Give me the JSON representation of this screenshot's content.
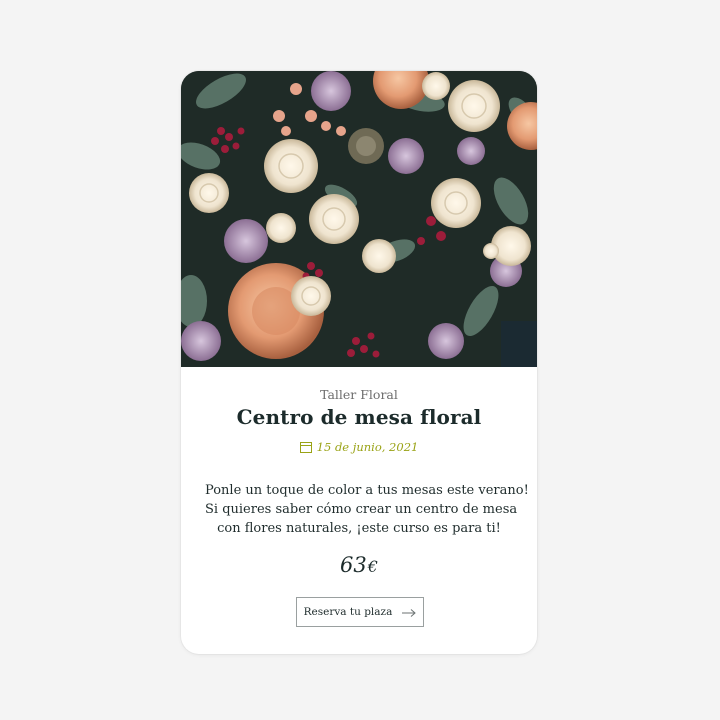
{
  "card": {
    "category": "Taller Floral",
    "title": "Centro de mesa floral",
    "date": "15 de junio, 2021",
    "description_lines": [
      "Ponle un toque de color a tus mesas este verano!",
      "Si quieres saber cómo crear un centro de mesa",
      "con flores naturales, ¡este curso es para ti!"
    ],
    "price": "63",
    "currency": "€",
    "button_label": "Reserva tu plaza"
  },
  "icons": {
    "date": "calendar-icon",
    "button": "arrow-right-icon"
  },
  "colors": {
    "background": "#f4f4f4",
    "card": "#ffffff",
    "title": "#1c2b2b",
    "date_accent": "#9aa316",
    "button_border": "#9aa0a0"
  }
}
